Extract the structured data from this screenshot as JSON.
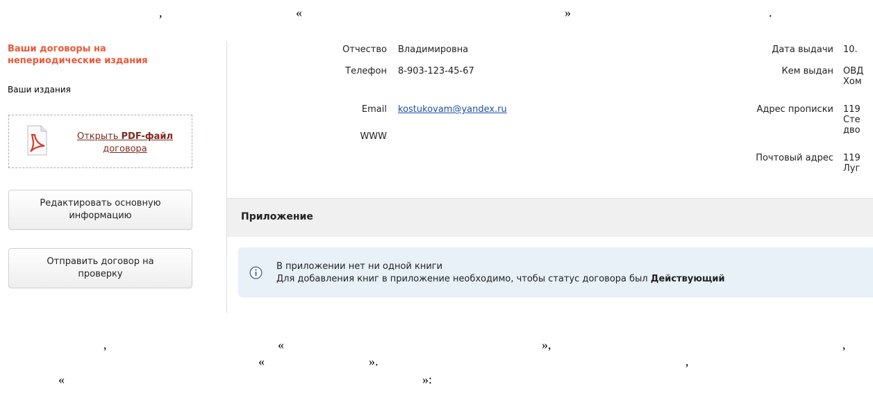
{
  "doc_text": {
    "top_comma": ",",
    "top_lquote": "«",
    "top_rquote": "»",
    "top_period": ".",
    "b1_comma_left": ",",
    "b1_lquote": "«",
    "b1_rquote_comma": "»,",
    "b1_comma_right": ",",
    "b2_lquote": "«",
    "b2_rquote_period": "».",
    "b2_comma": ",",
    "b3_lquote": "«",
    "b3_rquote_colon": "»:"
  },
  "sidebar": {
    "title": "Ваши договоры на непериодические издания",
    "editions_link": "Ваши издания",
    "pdf_link_prefix": "Открыть ",
    "pdf_link_bold": "PDF-файл",
    "pdf_link_suffix": "договора",
    "edit_button": "Редактировать основную информацию",
    "send_button": "Отправить договор на проверку"
  },
  "personal": {
    "patronymic_label": "Отчество",
    "patronymic_value": "Владимировна",
    "phone_label": "Телефон",
    "phone_value": "8-903-123-45-67",
    "email_label": "Email",
    "email_value": "kostukovam@yandex.ru",
    "www_label": "WWW"
  },
  "passport": {
    "issue_date_label": "Дата выдачи",
    "issue_date_value": "10.",
    "issued_by_label": "Кем выдан",
    "issued_by_value": "ОВД\nХом",
    "reg_address_label": "Адрес прописки",
    "reg_address_value": "119\nСте\nдво",
    "post_address_label": "Почтовый адрес",
    "post_address_value": "119\nЛуг"
  },
  "appendix": {
    "title": "Приложение",
    "line1": "В приложении нет ни одной книги",
    "line2_prefix": "Для добавления книг в приложение необходимо, чтобы статус договора был ",
    "line2_bold": "Действующий"
  }
}
